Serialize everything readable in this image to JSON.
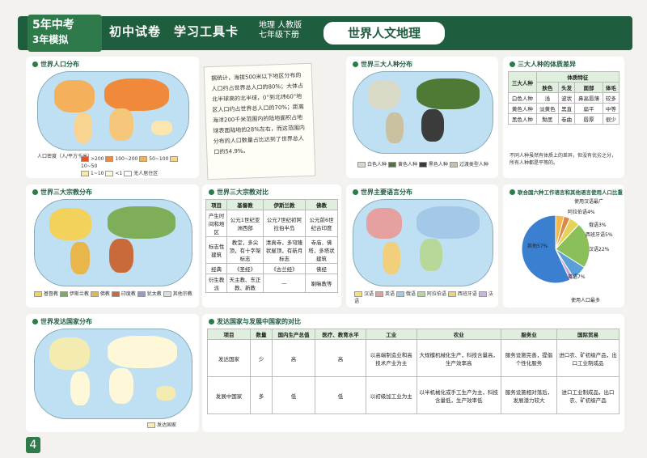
{
  "header": {
    "logo_top": "5年中考",
    "logo_bottom": "3年模拟",
    "title": "初中试卷　学习工具卡",
    "sub1": "地理  人教版",
    "sub2": "七年级下册",
    "topic": "世界人文地理"
  },
  "population_map": {
    "title": "世界人口分布",
    "legend_title": "人口密度（人/平方千米）",
    "legend": [
      ">200",
      "100~200",
      "50~100",
      "10~50",
      "1~10",
      "<1",
      "无人居住区"
    ]
  },
  "note": {
    "text": "据统计，海拔500米以下地区分布的人口约占世界总人口的80%；大体占北半球高的北半球，0°到北纬60°地区人口约占世界总人口的70%；距离海洋200千米范围内的陆地面积占地球表面陆地的28%左右，而这范围内分布的人口数量占比达到了世界总人口的54.9%。"
  },
  "races_map": {
    "title": "世界三大人种分布",
    "legend": [
      "白色人种",
      "黄色人种",
      "黑色人种",
      "过渡类型人种"
    ]
  },
  "races_table": {
    "title": "三大人种的体质差异",
    "col_group": "体质特征",
    "row_head": "三大人种",
    "cols": [
      "肤色",
      "头发",
      "面部",
      "体毛"
    ],
    "rows": [
      [
        "白色人种",
        "浅",
        "波状",
        "鼻高唇薄",
        "较多"
      ],
      [
        "黄色人种",
        "淡黄色",
        "黑直",
        "扁平",
        "中等"
      ],
      [
        "黑色人种",
        "黝黑",
        "卷曲",
        "唇厚",
        "很少"
      ]
    ],
    "footnote": "不同人种虽然有体质上的差异，但没有优劣之分，所有人种都是平等的。"
  },
  "religion_map": {
    "title": "世界三大宗教分布",
    "legend": [
      "基督教",
      "伊斯兰教",
      "佛教",
      "印度教",
      "犹太教",
      "其他宗教"
    ]
  },
  "religion_table": {
    "title": "世界三大宗教对比",
    "headers": [
      "项目",
      "基督教",
      "伊斯兰教",
      "佛教"
    ],
    "rows": [
      [
        "产生时间和地区",
        "公元1世纪亚洲西部",
        "公元7世纪初阿拉伯半岛",
        "公元前6世纪古印度"
      ],
      [
        "标志性建筑",
        "教堂，多尖顶，有十字架标志",
        "清真寺，多穹隆状屋顶，有新月标志",
        "寺庙、佛塔，多塔状建筑"
      ],
      [
        "经典",
        "《圣经》",
        "《古兰经》",
        "佛经"
      ],
      [
        "衍生教派",
        "天主教、东正教、新教",
        "—",
        "喇嘛教等"
      ]
    ]
  },
  "language_map": {
    "title": "世界主要语言分布",
    "legend": [
      "汉语",
      "英语",
      "俄语",
      "阿拉伯语",
      "西班牙语",
      "法语"
    ]
  },
  "language_pie": {
    "title": "联合国六种工作语言和其他语言使用人口比重",
    "slices": [
      {
        "name": "阿拉伯语",
        "value": 4
      },
      {
        "name": "俄语",
        "value": 3
      },
      {
        "name": "西班牙语",
        "value": 5
      },
      {
        "name": "汉语",
        "value": 22
      },
      {
        "name": "英语",
        "value": 7
      },
      {
        "name": "法语",
        "value": 2
      },
      {
        "name": "其他",
        "value": 57
      }
    ],
    "labels": [
      "阿拉伯语4%",
      "俄语3%",
      "西班牙语5%",
      "汉语22%",
      "英语7%",
      "其他57%"
    ],
    "callouts": [
      "使用汉语最广",
      "使用人口最多"
    ]
  },
  "dev_map": {
    "title": "世界发达国家分布",
    "legend": [
      "发达国家"
    ]
  },
  "dev_table": {
    "title": "发达国家与发展中国家的对比",
    "headers": [
      "项目",
      "数量",
      "国内生产总值",
      "医疗、教育水平",
      "工业",
      "农业",
      "服务业",
      "国际贸易"
    ],
    "rows": [
      [
        "发达国家",
        "少",
        "高",
        "高",
        "以高端制造业和高技术产业为主",
        "大规模机械化生产，科技含量高，生产效率高",
        "服务设施完善，提倡个性化服务",
        "进口农、矿初级产品，出口工业制成品"
      ],
      [
        "发展中国家",
        "多",
        "低",
        "低",
        "以初级加工业为主",
        "以半机械化或手工生产为主，科技含量低，生产效率低",
        "服务设施相对落后，发展潜力较大",
        "进口工业制成品，出口农、矿初级产品"
      ]
    ]
  },
  "page_number": "4"
}
